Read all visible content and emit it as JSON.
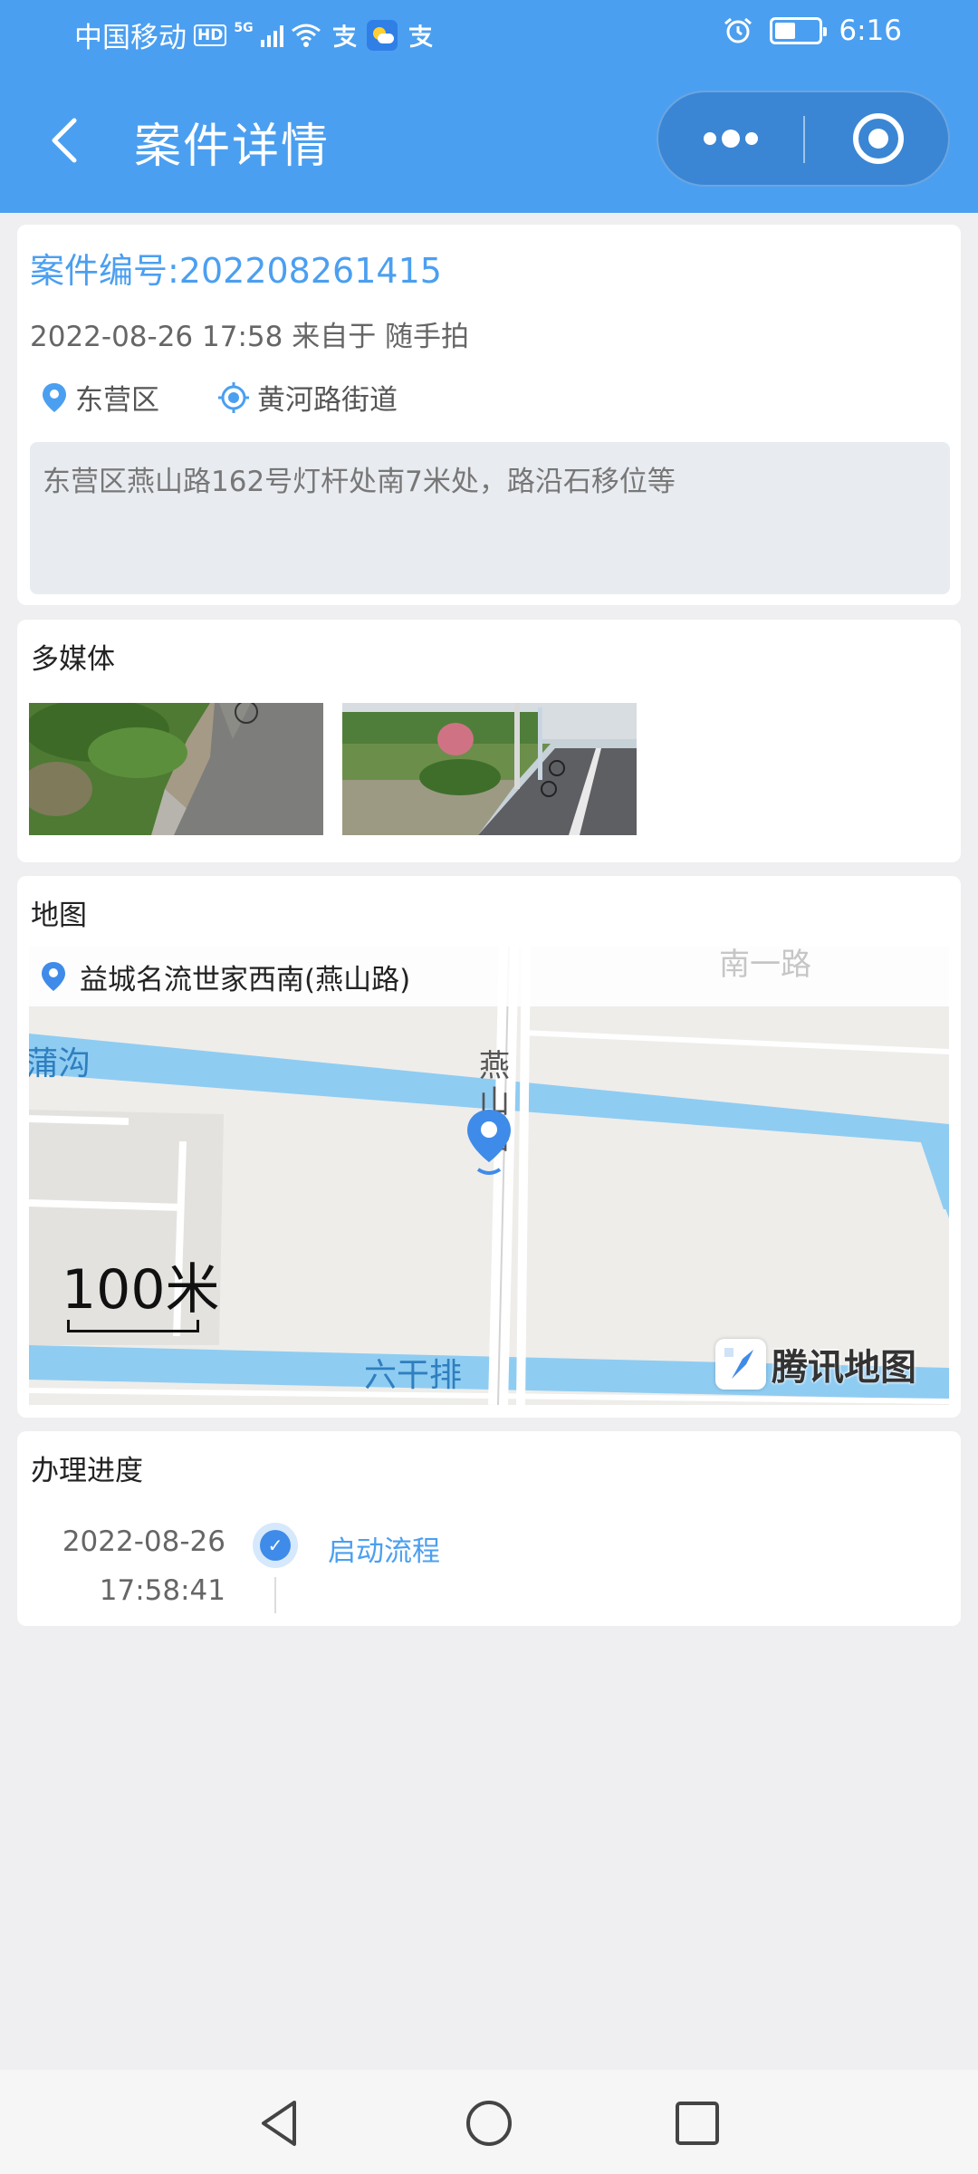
{
  "status_bar": {
    "carrier": "中国移动",
    "hd": "HD",
    "network": "5G",
    "time": "6:16",
    "icons": [
      "signal-icon",
      "wifi-icon",
      "alipay-icon",
      "weather-icon",
      "alipay-icon",
      "alarm-icon",
      "battery-icon"
    ]
  },
  "header": {
    "title": "案件详情",
    "back_icon": "chevron-left-icon",
    "more_icon": "more-dots-icon",
    "close_icon": "target-close-icon"
  },
  "case": {
    "number": "案件编号:202208261415",
    "meta": "2022-08-26 17:58 来自于 随手拍",
    "district": "东营区",
    "street": "黄河路街道",
    "description": "东营区燕山路162号灯杆处南7米处，路沿石移位等"
  },
  "media": {
    "title": "多媒体",
    "photos": [
      "photo-curb-1",
      "photo-curb-2"
    ]
  },
  "map": {
    "title": "地图",
    "address": "益城名流世家西南(燕山路)",
    "labels": {
      "canal_top": "蒲沟",
      "road_v1": "燕",
      "road_v2": "山",
      "road_v3": "路",
      "road_top": "南一路",
      "canal_bottom": "六干排"
    },
    "scale": "100米",
    "provider": "腾讯地图"
  },
  "progress": {
    "title": "办理进度",
    "items": [
      {
        "date": "2022-08-26",
        "time": "17:58:41",
        "step": "启动流程"
      }
    ]
  },
  "colors": {
    "primary": "#4b9ff0",
    "water": "#8fccf2"
  }
}
